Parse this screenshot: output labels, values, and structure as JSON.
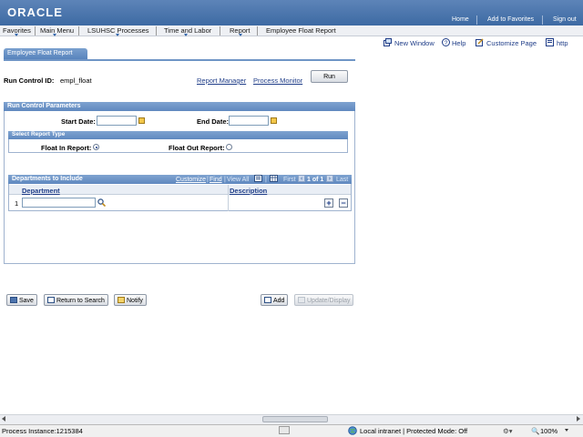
{
  "header": {
    "logo": "ORACLE",
    "links": [
      "Home",
      "Add to Favorites",
      "Sign out"
    ]
  },
  "nav": {
    "items": [
      "Favorites",
      "Main Menu",
      "LSUHSC Processes",
      "Time and Labor",
      "Report"
    ],
    "current": "Employee Float Report"
  },
  "utility": {
    "new_window": "New Window",
    "help": "Help",
    "customize": "Customize Page",
    "http": "http"
  },
  "page_tab": "Employee Float Report",
  "run_control": {
    "label": "Run Control ID:",
    "value": "empl_float",
    "report_manager": "Report Manager",
    "process_monitor": "Process Monitor",
    "run_button": "Run"
  },
  "params": {
    "title": "Run Control Parameters",
    "start_date_label": "Start Date:",
    "start_date_value": "",
    "end_date_label": "End Date:",
    "end_date_value": "",
    "report_type_title": "Select Report Type",
    "float_in_label": "Float In Report:",
    "float_out_label": "Float Out Report:",
    "selected": "float_in"
  },
  "departments": {
    "title": "Departments to Include",
    "customize": "Customize",
    "find": "Find",
    "view_all": "View All",
    "first": "First",
    "pager": "1 of 1",
    "last": "Last",
    "col_department": "Department",
    "col_description": "Description",
    "rows": [
      {
        "num": "1",
        "department": "",
        "description": ""
      }
    ]
  },
  "buttons": {
    "save": "Save",
    "return_to_search": "Return to Search",
    "notify": "Notify",
    "add": "Add",
    "update_display": "Update/Display"
  },
  "statusbar": {
    "process_instance": "Process Instance:1215384",
    "zone": "Local intranet | Protected Mode: Off",
    "zoom": "100%"
  }
}
